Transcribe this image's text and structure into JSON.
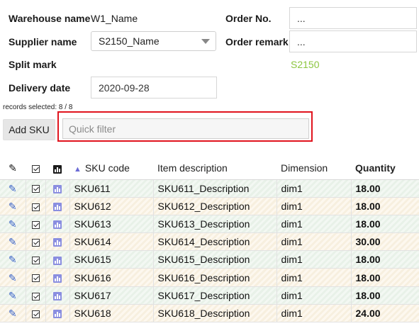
{
  "form": {
    "warehouse_label": "Warehouse name",
    "warehouse_value": "W1_Name",
    "order_no_label": "Order No.",
    "order_no_value": "...",
    "supplier_label": "Supplier name",
    "supplier_value": "S2150_Name",
    "order_remark_label": "Order remark",
    "order_remark_value": "...",
    "split_mark_label": "Split mark",
    "split_mark_value": "S2150",
    "delivery_date_label": "Delivery date",
    "delivery_date_value": "2020-09-28"
  },
  "records_selected": "records selected: 8 / 8",
  "toolbar": {
    "add_sku_label": "Add SKU",
    "quick_filter_placeholder": "Quick filter"
  },
  "table": {
    "headers": {
      "sku_code": "SKU code",
      "item_description": "Item description",
      "dimension": "Dimension",
      "quantity": "Quantity"
    },
    "rows": [
      {
        "sku": "SKU611",
        "desc": "SKU611_Description",
        "dim": "dim1",
        "qty": "18.00"
      },
      {
        "sku": "SKU612",
        "desc": "SKU612_Description",
        "dim": "dim1",
        "qty": "18.00"
      },
      {
        "sku": "SKU613",
        "desc": "SKU613_Description",
        "dim": "dim1",
        "qty": "18.00"
      },
      {
        "sku": "SKU614",
        "desc": "SKU614_Description",
        "dim": "dim1",
        "qty": "30.00"
      },
      {
        "sku": "SKU615",
        "desc": "SKU615_Description",
        "dim": "dim1",
        "qty": "18.00"
      },
      {
        "sku": "SKU616",
        "desc": "SKU616_Description",
        "dim": "dim1",
        "qty": "18.00"
      },
      {
        "sku": "SKU617",
        "desc": "SKU617_Description",
        "dim": "dim1",
        "qty": "18.00"
      },
      {
        "sku": "SKU618",
        "desc": "SKU618_Description",
        "dim": "dim1",
        "qty": "24.00"
      }
    ]
  },
  "icons": {
    "edit": "pencil-icon",
    "select": "checkbox-icon",
    "detail": "bar-chart-icon",
    "sort": "sort-ascending-icon"
  },
  "colors": {
    "split_mark": "#8cc63f",
    "highlight": "#e0141e",
    "icon_blue": "#3a63c8",
    "chart_icon": "#8a8ee0"
  }
}
